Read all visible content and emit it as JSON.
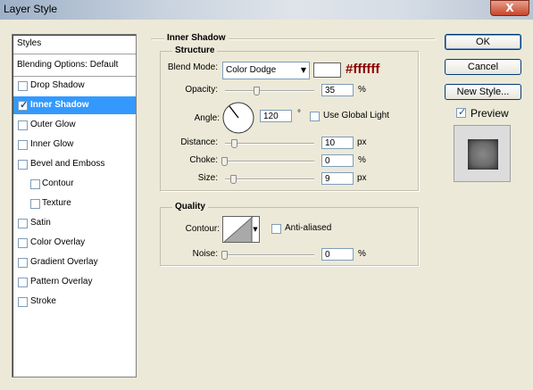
{
  "window": {
    "title": "Layer Style",
    "close_glyph": "X"
  },
  "styles_panel": {
    "header": "Styles",
    "blending": "Blending Options: Default",
    "items": [
      {
        "label": "Drop Shadow",
        "checked": false
      },
      {
        "label": "Inner Shadow",
        "checked": true,
        "selected": true
      },
      {
        "label": "Outer Glow",
        "checked": false
      },
      {
        "label": "Inner Glow",
        "checked": false
      },
      {
        "label": "Bevel and Emboss",
        "checked": false
      },
      {
        "label": "Contour",
        "checked": false,
        "indent": true
      },
      {
        "label": "Texture",
        "checked": false,
        "indent": true
      },
      {
        "label": "Satin",
        "checked": false
      },
      {
        "label": "Color Overlay",
        "checked": false
      },
      {
        "label": "Gradient Overlay",
        "checked": false
      },
      {
        "label": "Pattern Overlay",
        "checked": false
      },
      {
        "label": "Stroke",
        "checked": false
      }
    ]
  },
  "inner_shadow": {
    "title": "Inner Shadow",
    "structure": {
      "title": "Structure",
      "blend_mode_label": "Blend Mode:",
      "blend_mode": "Color Dodge",
      "color": "#ffffff",
      "color_annotation": "#ffffff",
      "opacity_label": "Opacity:",
      "opacity": "35",
      "opacity_unit": "%",
      "angle_label": "Angle:",
      "angle": "120",
      "angle_unit": "°",
      "use_global_light": "Use Global Light",
      "distance_label": "Distance:",
      "distance": "10",
      "distance_unit": "px",
      "choke_label": "Choke:",
      "choke": "0",
      "choke_unit": "%",
      "size_label": "Size:",
      "size": "9",
      "size_unit": "px"
    },
    "quality": {
      "title": "Quality",
      "contour_label": "Contour:",
      "anti_aliased": "Anti-aliased",
      "noise_label": "Noise:",
      "noise": "0",
      "noise_unit": "%"
    }
  },
  "buttons": {
    "ok": "OK",
    "cancel": "Cancel",
    "new_style": "New Style...",
    "preview": "Preview"
  }
}
